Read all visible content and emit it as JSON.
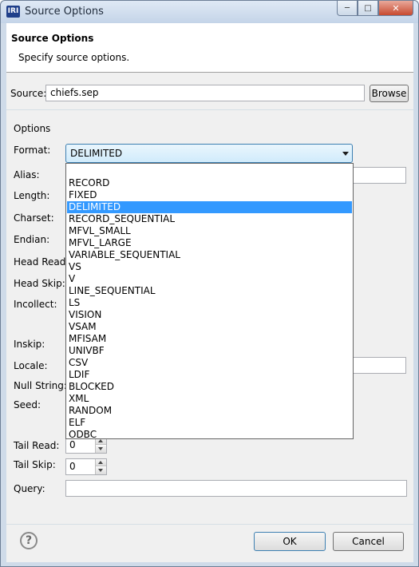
{
  "window": {
    "icon_text": "IRI",
    "title": "Source Options"
  },
  "header": {
    "title": "Source Options",
    "description": "Specify source options."
  },
  "source": {
    "label": "Source:",
    "value": "chiefs.sep",
    "browse_label": "Browse"
  },
  "options": {
    "group_label": "Options",
    "format_label": "Format:",
    "format_value": "DELIMITED",
    "format_options": [
      "",
      "RECORD",
      "FIXED",
      "DELIMITED",
      "RECORD_SEQUENTIAL",
      "MFVL_SMALL",
      "MFVL_LARGE",
      "VARIABLE_SEQUENTIAL",
      "VS",
      "V",
      "LINE_SEQUENTIAL",
      "LS",
      "VISION",
      "VSAM",
      "MFISAM",
      "UNIVBF",
      "CSV",
      "LDIF",
      "BLOCKED",
      "XML",
      "RANDOM",
      "ELF",
      "ODBC"
    ],
    "alias_label": "Alias:",
    "length_label": "Length:",
    "charset_label": "Charset:",
    "endian_label": "Endian:",
    "head_read_label": "Head Read:",
    "head_skip_label": "Head Skip:",
    "incollect_label": "Incollect:",
    "inskip_label": "Inskip:",
    "locale_label": "Locale:",
    "null_string_label": "Null String:",
    "seed_label": "Seed:",
    "tail_read_label": "Tail Read:",
    "tail_read_value": "0",
    "tail_skip_label": "Tail Skip:",
    "tail_skip_value": "0",
    "query_label": "Query:"
  },
  "footer": {
    "help_symbol": "?",
    "ok_label": "OK",
    "cancel_label": "Cancel"
  },
  "colors": {
    "selection": "#3399ff",
    "combo_border": "#3c7fb1"
  }
}
